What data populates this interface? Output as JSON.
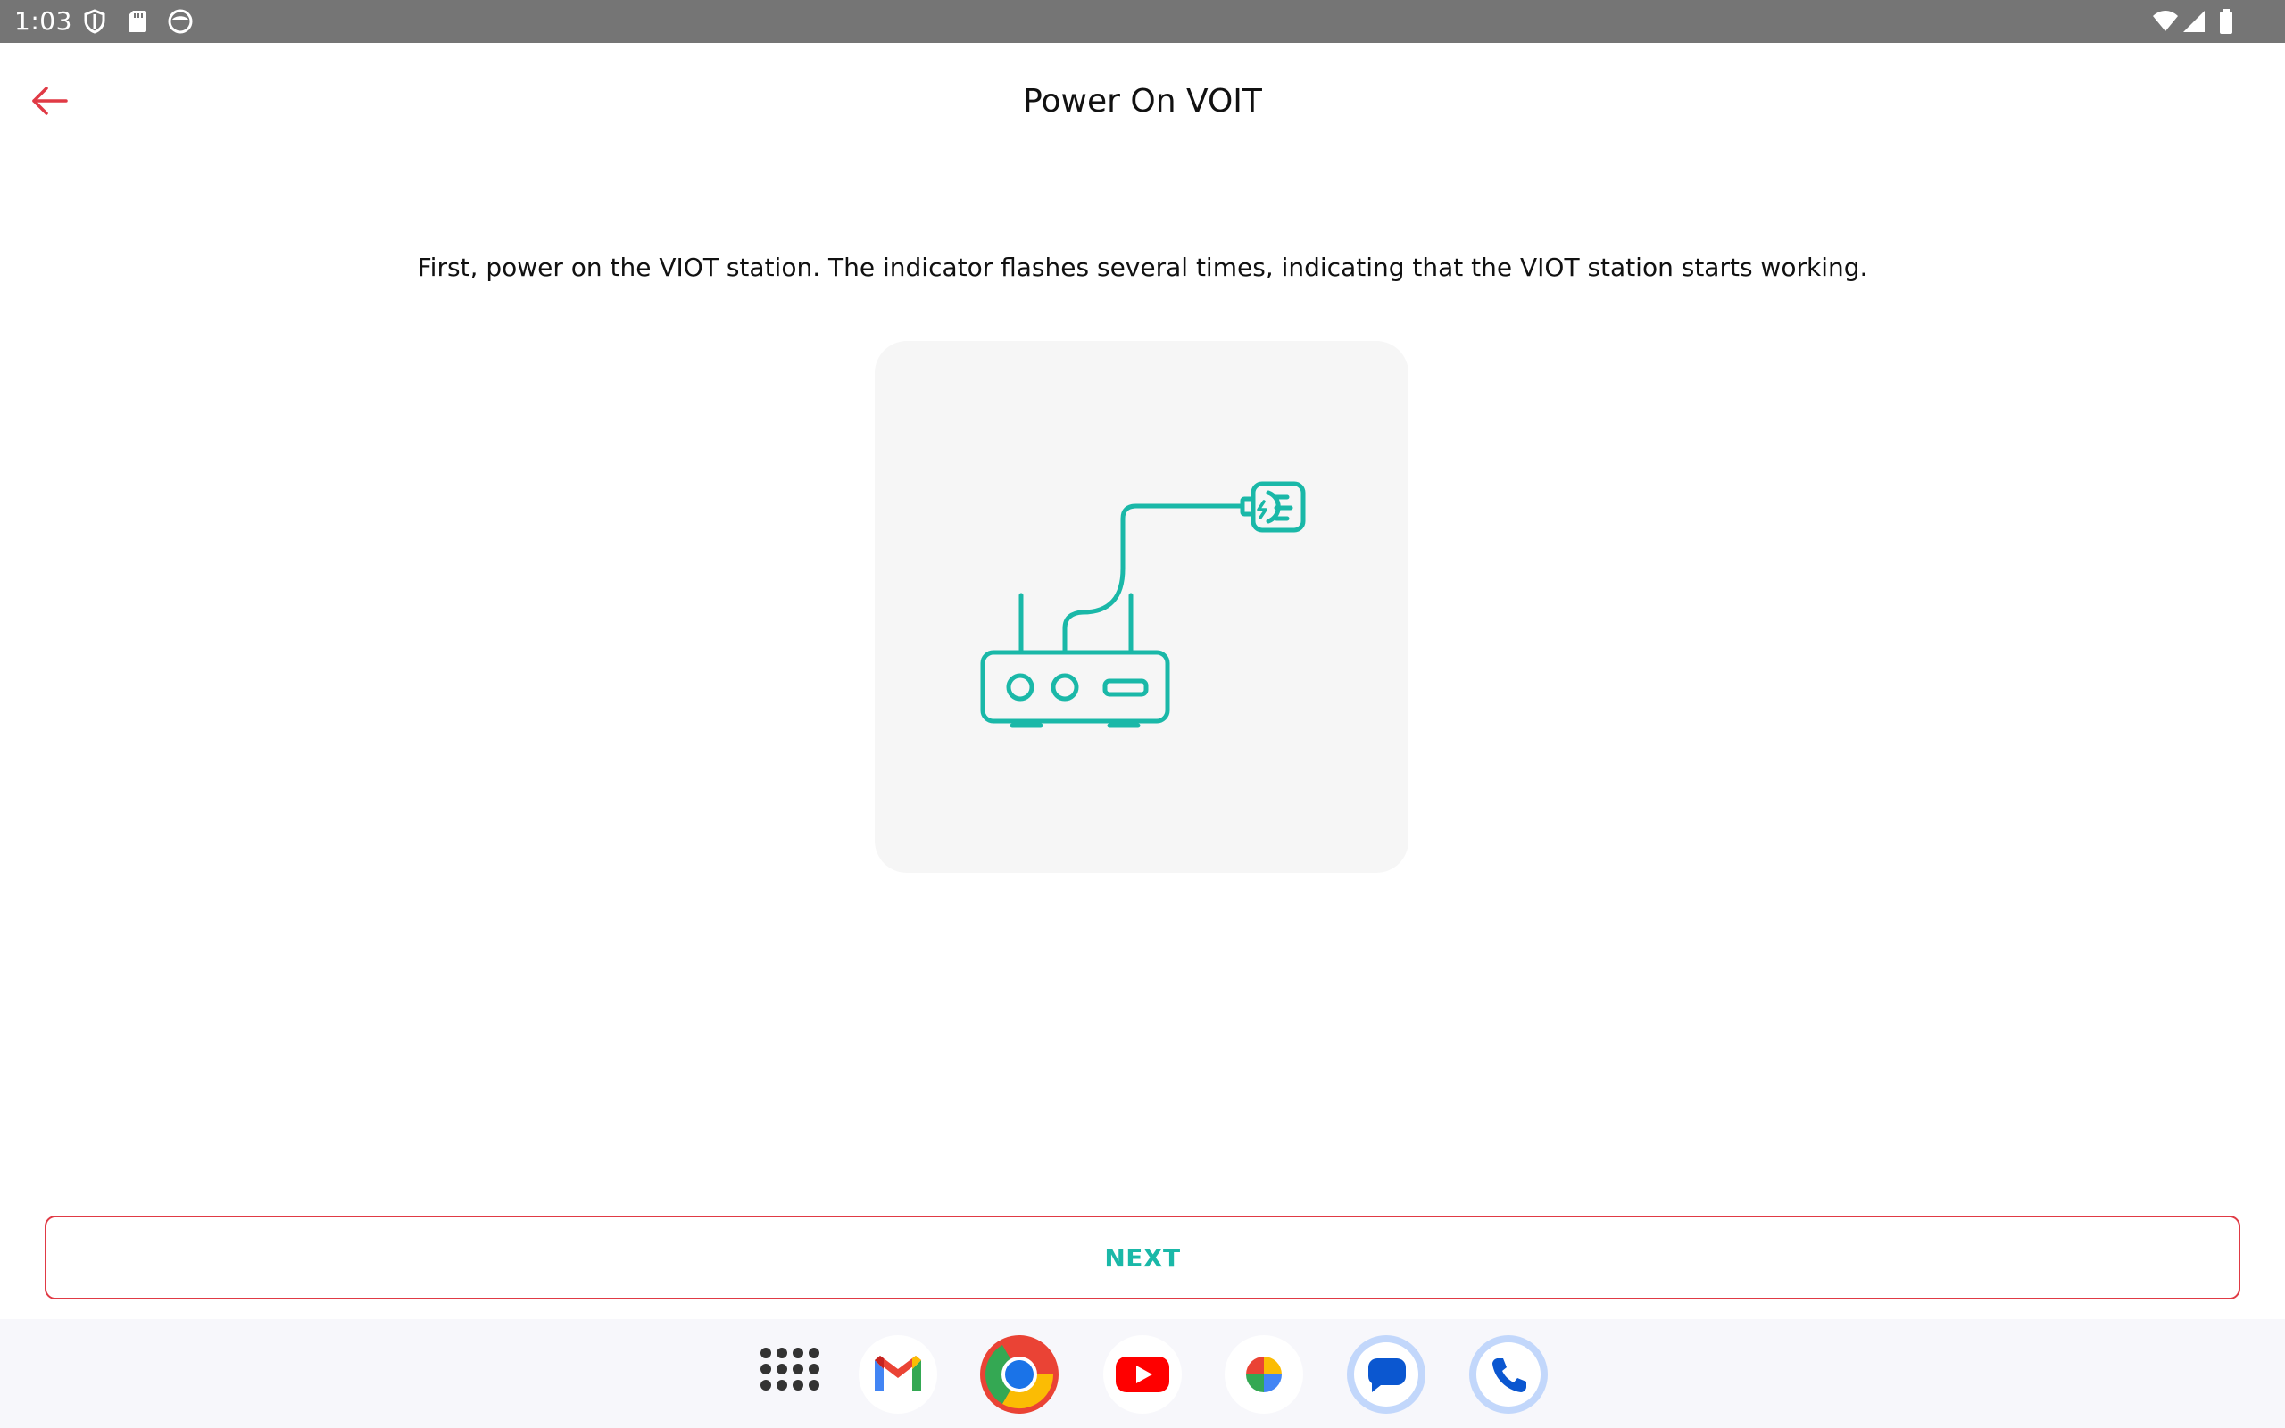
{
  "status_bar": {
    "time": "1:03",
    "left_icons": [
      "shield-icon",
      "sd-card-icon",
      "face-icon"
    ],
    "right_icons": [
      "wifi-icon",
      "signal-icon",
      "battery-icon"
    ]
  },
  "app_bar": {
    "back_icon": "arrow-left-icon",
    "title": "Power On VOIT"
  },
  "main": {
    "instruction": "First, power on the VIOT station. The indicator flashes several times, indicating that the VIOT station starts working.",
    "illustration_icon": "router-power-plug-icon"
  },
  "footer": {
    "next_label": "NEXT"
  },
  "dock": {
    "apps": [
      "app-drawer-icon",
      "gmail-icon",
      "chrome-icon",
      "youtube-icon",
      "photos-icon",
      "messages-icon",
      "phone-icon"
    ]
  },
  "colors": {
    "accent": "#e03a45",
    "teal": "#1ab8a8",
    "status_bar": "#757575",
    "card_bg": "#f6f6f6"
  }
}
